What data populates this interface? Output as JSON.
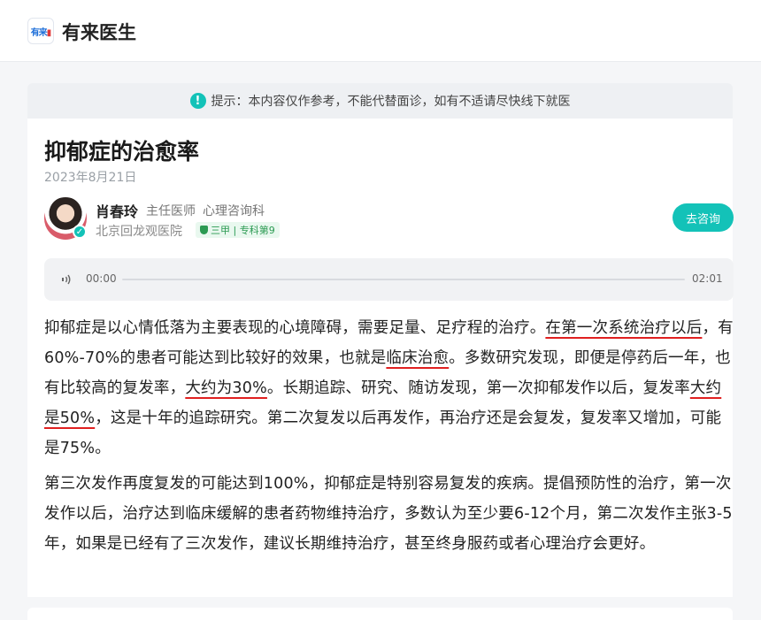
{
  "header": {
    "logo_text_blue": "有来",
    "logo_text_red": "▮",
    "brand": "有来医生"
  },
  "notice": {
    "icon": "exclamation-icon",
    "text": "提示：本内容仅作参考，不能代替面诊，如有不适请尽快线下就医"
  },
  "article": {
    "title": "抑郁症的治愈率",
    "date": "2023年8月21日"
  },
  "doctor": {
    "name": "肖春玲",
    "title": "主任医师",
    "department": "心理咨询科",
    "hospital": "北京回龙观医院",
    "grade": "三甲 | 专科第9",
    "consult_label": "去咨询"
  },
  "audio": {
    "current": "00:00",
    "duration": "02:01",
    "progress": 0
  },
  "body": {
    "p1_a": "抑郁症是以心情低落为主要表现的心境障碍，需要足量、足疗程的治疗。",
    "p1_b": "在第一次系统治疗以后",
    "p1_c": "，有60%-70%的患者可能达到比较好的效果，也就是",
    "p1_d": "临床治愈",
    "p1_e": "。多数研究发现，即便是停药后一年，也有比较高的复发率，",
    "p1_f": "大约为30%",
    "p1_g": "。长期追踪、研究、随访发现，第一次抑郁发作以后，复发率",
    "p1_h": "大约是50%",
    "p1_i": "，这是十年的追踪研究。第二次复发以后再发作，再治疗还是会复发，复发率又增加，可能是75%。",
    "p2": "第三次发作再度复发的可能达到100%，抑郁症是特别容易复发的疾病。提倡预防性的治疗，第一次发作以后，治疗达到临床缓解的患者药物维持治疗，多数认为至少要6-12个月，第二次发作主张3-5年，如果是已经有了三次发作，建议长期维持治疗，甚至终身服药或者心理治疗会更好。"
  },
  "colors": {
    "accent": "#13c2b8",
    "underline": "#e02020",
    "badge_green": "#2b9a52"
  }
}
